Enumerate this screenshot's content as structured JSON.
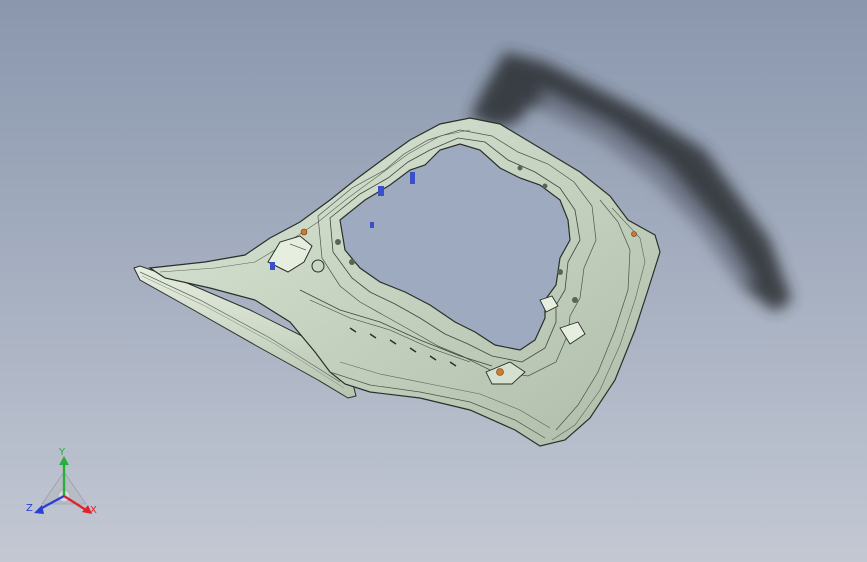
{
  "viewport": {
    "background_top": "#8a97ad",
    "background_bottom": "#c3c8d3"
  },
  "model": {
    "name": "liftgate-inner-panel",
    "surface_color": "#c9d6c4",
    "edge_color": "#2a2f2a",
    "shadow_color": "#2b2e33",
    "accent_colors": {
      "fastener": "#d07a2a",
      "clip": "#3a4fc8"
    }
  },
  "triad": {
    "icon": "coordinate-axes-triad-icon",
    "labels": {
      "x": "X",
      "y": "Y",
      "z": "Z"
    },
    "colors": {
      "x": "#e0232a",
      "y": "#26b03b",
      "z": "#2a3fd6"
    }
  }
}
